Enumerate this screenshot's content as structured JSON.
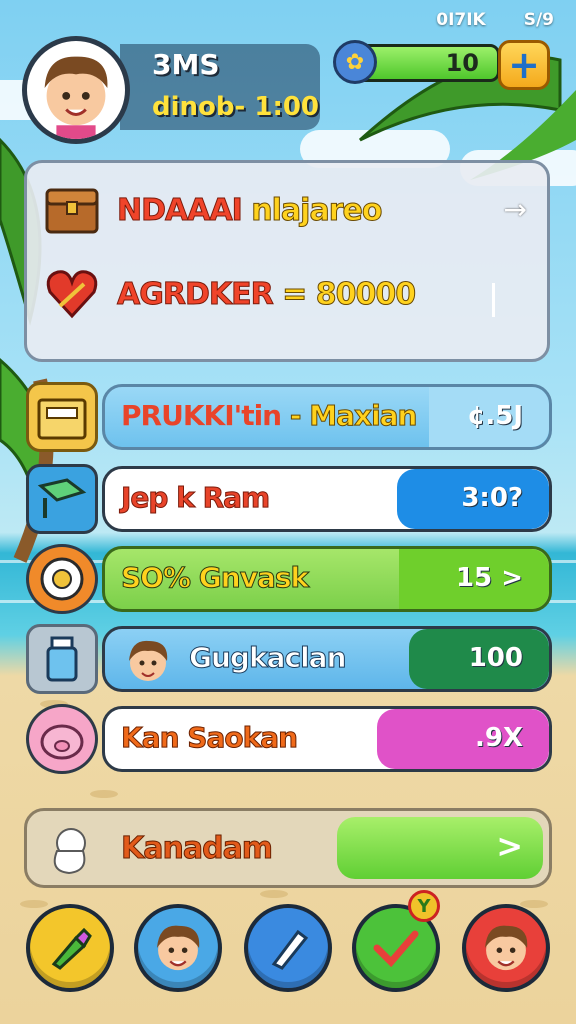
{
  "status": {
    "left": "0I7IK",
    "right": "S/9"
  },
  "player": {
    "name": "3MS",
    "subtitle": "dinob- 1:00"
  },
  "currency": {
    "value": "10",
    "plus_label": "+",
    "fill_fraction": 1.0
  },
  "panel": {
    "row1": {
      "title_a": "NDAAAI ",
      "title_b": "nlajareo"
    },
    "row2": {
      "title_a": "AGRDKER ",
      "title_b": "= 80000"
    },
    "arrow": "→"
  },
  "rows": [
    {
      "label_a": "PRUKKI'tin ",
      "label_b": "- Maxian",
      "value": "¢.5J",
      "pill_color": "#7ecbf0",
      "cap_color": "#8fd2f4"
    },
    {
      "label": "Jep k Ram",
      "value": "3:0?",
      "pill_color": "#ffffff",
      "cap_color": "#1e8de6"
    },
    {
      "label": "SO% Gnvask",
      "value": "15 >",
      "pill_color": "#8cd84a",
      "cap_color": "#6fcf2c"
    },
    {
      "label": "Gugkaclan",
      "value": "100",
      "pill_color": "#6cc2ef",
      "cap_color": "#1f8a4a"
    },
    {
      "label": "Kan Saokan",
      "value": ".9X",
      "pill_color": "#ffffff",
      "cap_color": "#e052c8"
    }
  ],
  "bottom": {
    "label": "Kanadam",
    "arrow": ">"
  },
  "nav": [
    {
      "name": "brush",
      "color": "#f3c62b"
    },
    {
      "name": "avatar",
      "color": "#4aa8e6"
    },
    {
      "name": "pen",
      "color": "#3a8ae0"
    },
    {
      "name": "check",
      "color": "#4cc23a"
    },
    {
      "name": "avatar-2",
      "color": "#e8403a"
    }
  ],
  "nav_badge": "Y"
}
